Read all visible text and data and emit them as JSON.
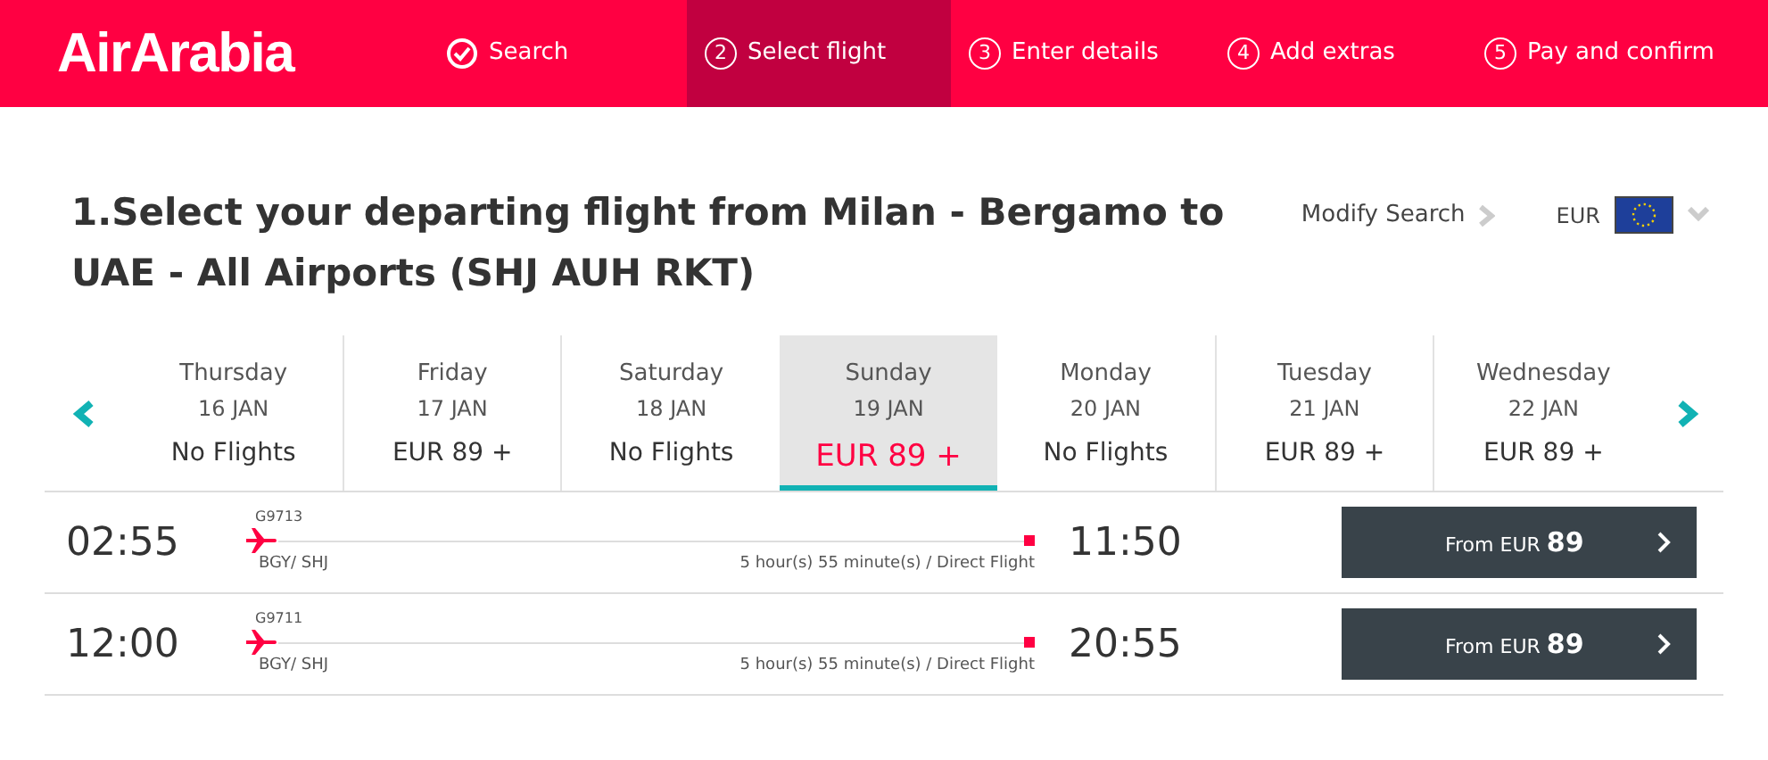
{
  "logo": "AirArabia",
  "steps": [
    {
      "kind": "done",
      "label": "Search",
      "selected": false
    },
    {
      "kind": "number",
      "number": "2",
      "label": "Select flight",
      "selected": true
    },
    {
      "kind": "number",
      "number": "3",
      "label": "Enter details",
      "selected": false
    },
    {
      "kind": "number",
      "number": "4",
      "label": "Add extras",
      "selected": false
    },
    {
      "kind": "number",
      "number": "5",
      "label": "Pay and confirm",
      "selected": false
    }
  ],
  "heading": "1.Select your departing flight from Milan - Bergamo to UAE - All Airports (SHJ AUH RKT)",
  "modify_search": "Modify Search",
  "currency": "EUR",
  "dates": [
    {
      "day": "Thursday",
      "date": "16 JAN",
      "price": "No Flights",
      "selected": false
    },
    {
      "day": "Friday",
      "date": "17 JAN",
      "price": "EUR 89 +",
      "selected": false
    },
    {
      "day": "Saturday",
      "date": "18 JAN",
      "price": "No Flights",
      "selected": false
    },
    {
      "day": "Sunday",
      "date": "19 JAN",
      "price": "EUR 89 +",
      "selected": true
    },
    {
      "day": "Monday",
      "date": "20 JAN",
      "price": "No Flights",
      "selected": false
    },
    {
      "day": "Tuesday",
      "date": "21 JAN",
      "price": "EUR 89 +",
      "selected": false
    },
    {
      "day": "Wednesday",
      "date": "22 JAN",
      "price": "EUR 89 +",
      "selected": false
    }
  ],
  "flights": [
    {
      "depart": "02:55",
      "flight_no": "G9713",
      "route": "BGY/ SHJ",
      "duration": "5 hour(s) 55 minute(s) / Direct Flight",
      "arrive": "11:50",
      "button": "From EUR **89**"
    },
    {
      "depart": "12:00",
      "flight_no": "G9711",
      "route": "BGY/ SHJ",
      "duration": "5 hour(s) 55 minute(s) / Direct Flight",
      "arrive": "20:55",
      "button": "From EUR **89**"
    }
  ]
}
